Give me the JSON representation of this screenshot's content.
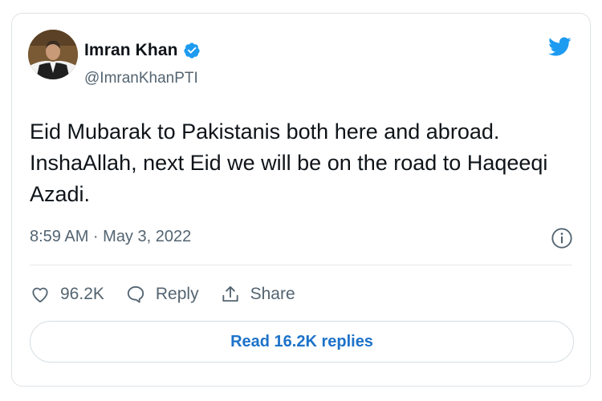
{
  "tweet": {
    "author_name": "Imran Khan",
    "handle": "@ImranKhanPTI",
    "text": "Eid Mubarak to Pakistanis both here and abroad. InshaAllah, next Eid we will be on the road to Haqeeqi Azadi.",
    "timestamp": "8:59 AM · May 3, 2022"
  },
  "actions": {
    "like_count": "96.2K",
    "reply_label": "Reply",
    "share_label": "Share"
  },
  "read_replies_label": "Read 16.2K replies",
  "icons": {
    "verified": "verified-badge-icon",
    "brand": "twitter-bird-icon",
    "info": "info-icon",
    "like": "heart-icon",
    "reply": "speech-bubble-icon",
    "share": "share-arrow-icon"
  },
  "colors": {
    "brand": "#1d9bf0",
    "link": "#1d72c9",
    "text": "#0f1419",
    "secondary": "#536471"
  }
}
